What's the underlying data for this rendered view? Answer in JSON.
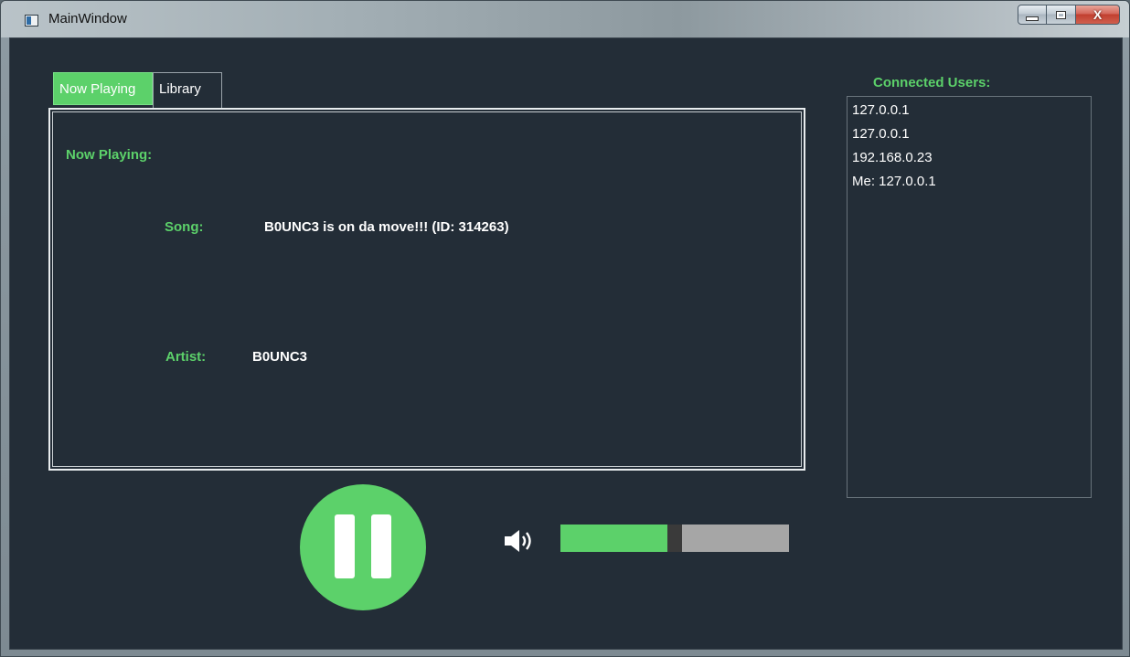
{
  "window": {
    "title": "MainWindow",
    "close_glyph": "X"
  },
  "tabs": [
    {
      "label": "Now Playing",
      "active": true
    },
    {
      "label": "Library",
      "active": false
    }
  ],
  "now_playing": {
    "heading": "Now Playing:",
    "song_label": "Song:",
    "song_value": "B0UNC3 is on da move!!! (ID: 314263)",
    "artist_label": "Artist:",
    "artist_value": "B0UNC3"
  },
  "controls": {
    "play_state": "paused",
    "pause_icon": "pause-icon",
    "volume_icon": "speaker-icon",
    "volume_fraction": 0.5
  },
  "users": {
    "title": "Connected Users:",
    "items": [
      "127.0.0.1",
      "127.0.0.1",
      "192.168.0.23",
      "Me: 127.0.0.1"
    ]
  },
  "colors": {
    "accent": "#5cd16a",
    "background": "#232d37",
    "text": "#ffffff",
    "slider_track": "#a6a6a6",
    "slider_handle": "#3a3a3a"
  }
}
